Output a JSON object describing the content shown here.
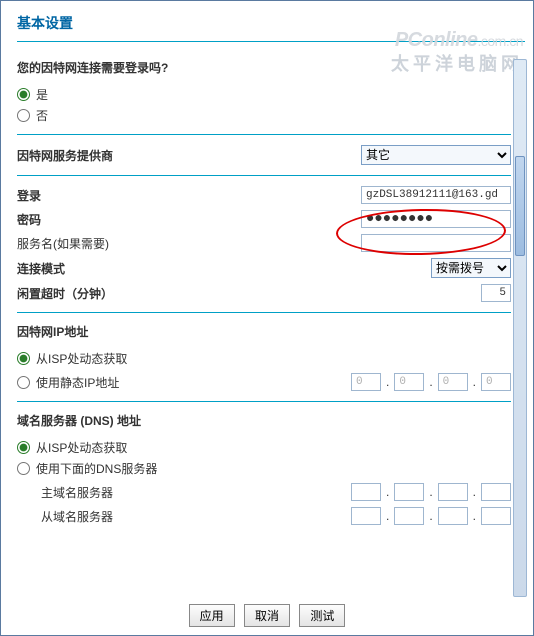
{
  "title": "基本设置",
  "watermark": {
    "line1a": "PConline",
    "line1b": ".com.cn",
    "line2": "太平洋电脑网"
  },
  "login_req": {
    "question": "您的因特网连接需要登录吗?",
    "yes": "是",
    "no": "否"
  },
  "isp": {
    "label": "因特网服务提供商",
    "selected": "其它"
  },
  "fields": {
    "login_label": "登录",
    "login_value": "gzDSL38912111@163.gd",
    "password_label": "密码",
    "password_value": "●●●●●●●●",
    "service_label": "服务名(如果需要)",
    "service_value": "",
    "mode_label": "连接模式",
    "mode_value": "按需拨号",
    "idle_label": "闲置超时（分钟）",
    "idle_value": "5"
  },
  "ip": {
    "heading": "因特网IP地址",
    "opt_dynamic": "从ISP处动态获取",
    "opt_static": "使用静态IP地址",
    "o1": "0",
    "o2": "0",
    "o3": "0",
    "o4": "0"
  },
  "dns": {
    "heading": "域名服务器 (DNS) 地址",
    "opt_dynamic": "从ISP处动态获取",
    "opt_static": "使用下面的DNS服务器",
    "primary_label": "主域名服务器",
    "secondary_label": "从域名服务器"
  },
  "buttons": {
    "apply": "应用",
    "cancel": "取消",
    "test": "测试"
  }
}
